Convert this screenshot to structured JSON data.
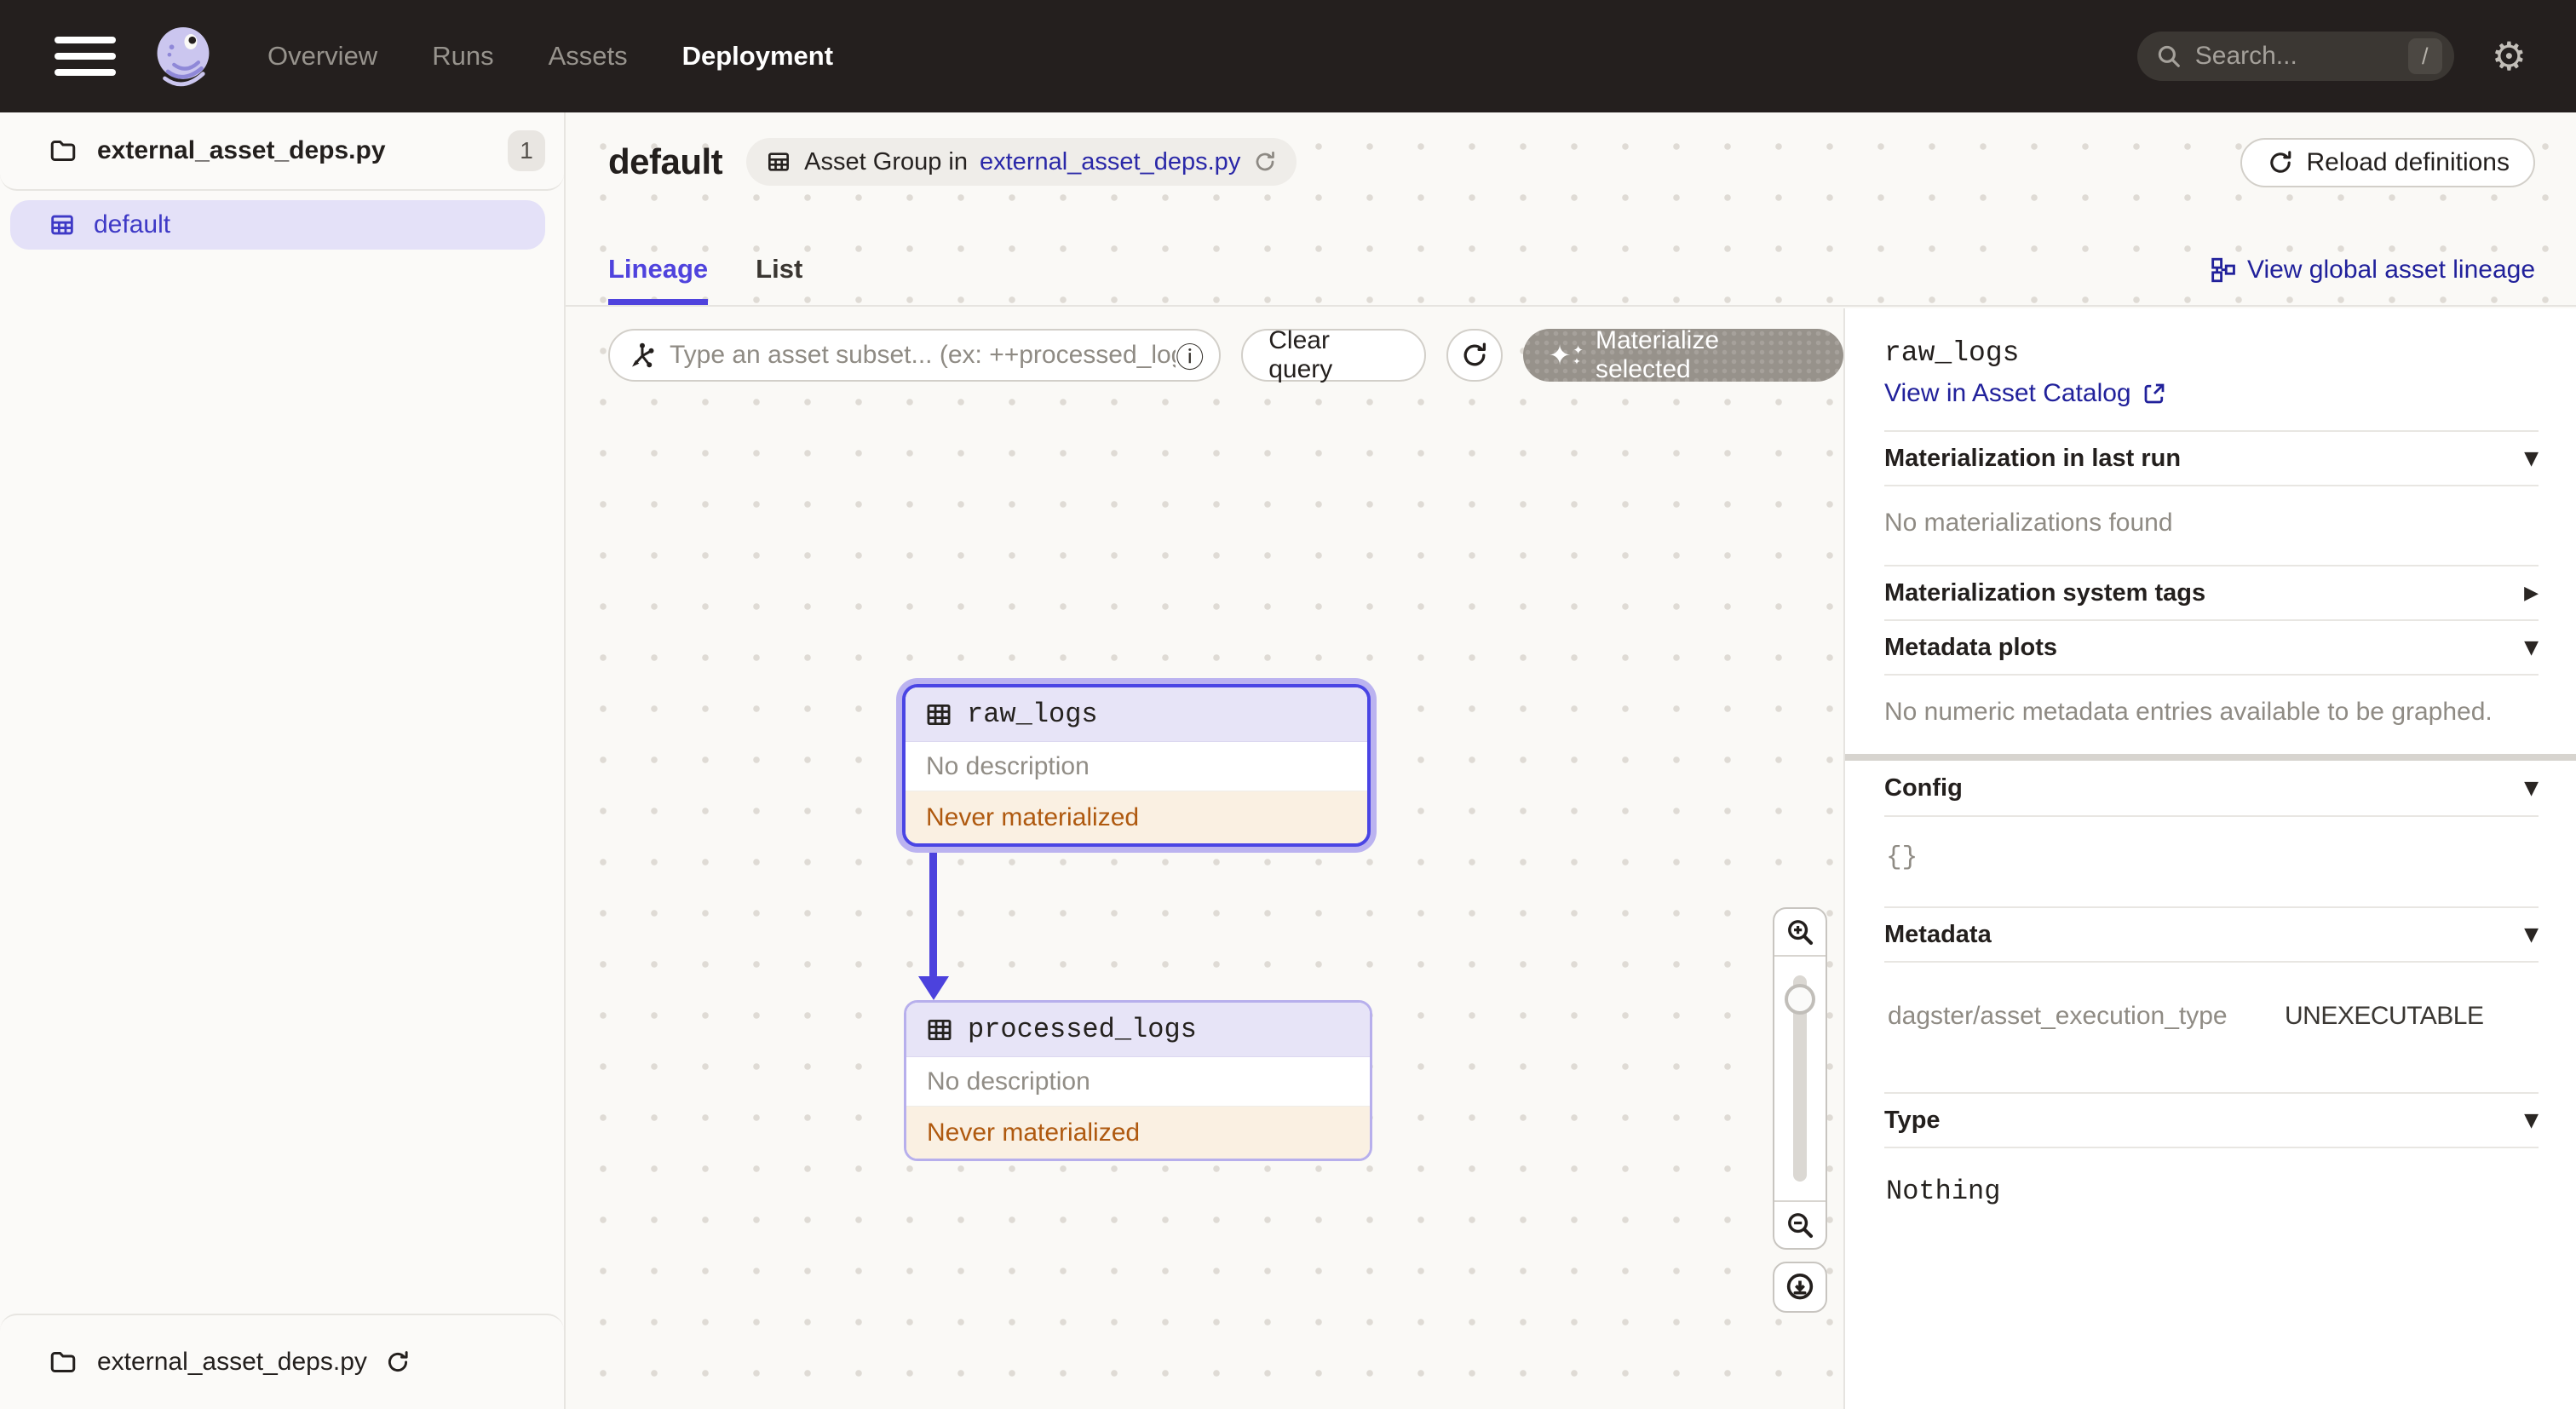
{
  "nav": {
    "items": [
      {
        "label": "Overview",
        "active": false
      },
      {
        "label": "Runs",
        "active": false
      },
      {
        "label": "Assets",
        "active": false
      },
      {
        "label": "Deployment",
        "active": true
      }
    ],
    "search": {
      "placeholder": "Search...",
      "shortcut": "/"
    }
  },
  "sidebar": {
    "file_label": "external_asset_deps.py",
    "file_count": "1",
    "selected_group": "default",
    "footer_label": "external_asset_deps.py"
  },
  "header": {
    "title": "default",
    "breadcrumb_prefix": "Asset Group in",
    "breadcrumb_link": "external_asset_deps.py",
    "reload_label": "Reload definitions"
  },
  "tabs": [
    {
      "label": "Lineage",
      "active": true
    },
    {
      "label": "List",
      "active": false
    }
  ],
  "global_lineage_label": "View global asset lineage",
  "toolbar": {
    "query_placeholder": "Type an asset subset... (ex: ++processed_logs",
    "clear_label": "Clear query",
    "materialize_label": "Materialize selected"
  },
  "graph": {
    "nodes": [
      {
        "name": "raw_logs",
        "description": "No description",
        "status": "Never materialized",
        "selected": true
      },
      {
        "name": "processed_logs",
        "description": "No description",
        "status": "Never materialized",
        "selected": false
      }
    ]
  },
  "panel": {
    "title": "raw_logs",
    "catalog_link_label": "View in Asset Catalog",
    "sections": [
      {
        "label": "Materialization in last run",
        "body": "No materializations found"
      },
      {
        "label": "Materialization system tags"
      },
      {
        "label": "Metadata plots",
        "body": "No numeric metadata entries available to be graphed."
      },
      {
        "label": "Config",
        "body": "{}"
      },
      {
        "label": "Metadata",
        "key": "dagster/asset_execution_type",
        "value": "UNEXECUTABLE"
      },
      {
        "label": "Type",
        "body": "Nothing"
      }
    ]
  },
  "icons": {
    "caret_down": "▼",
    "caret_right": "▶",
    "gear": "⚙",
    "sparkle": "✦",
    "info": "ⓘ"
  },
  "colors": {
    "accent_blurple": "#4F43DD",
    "link_navy": "#21219B",
    "selected_node_border": "#4A45E4",
    "node_border": "#B7AFEC",
    "warning_text": "#AF590F",
    "warning_bg": "#FAF0E2",
    "nav_bg": "#241F1E"
  }
}
